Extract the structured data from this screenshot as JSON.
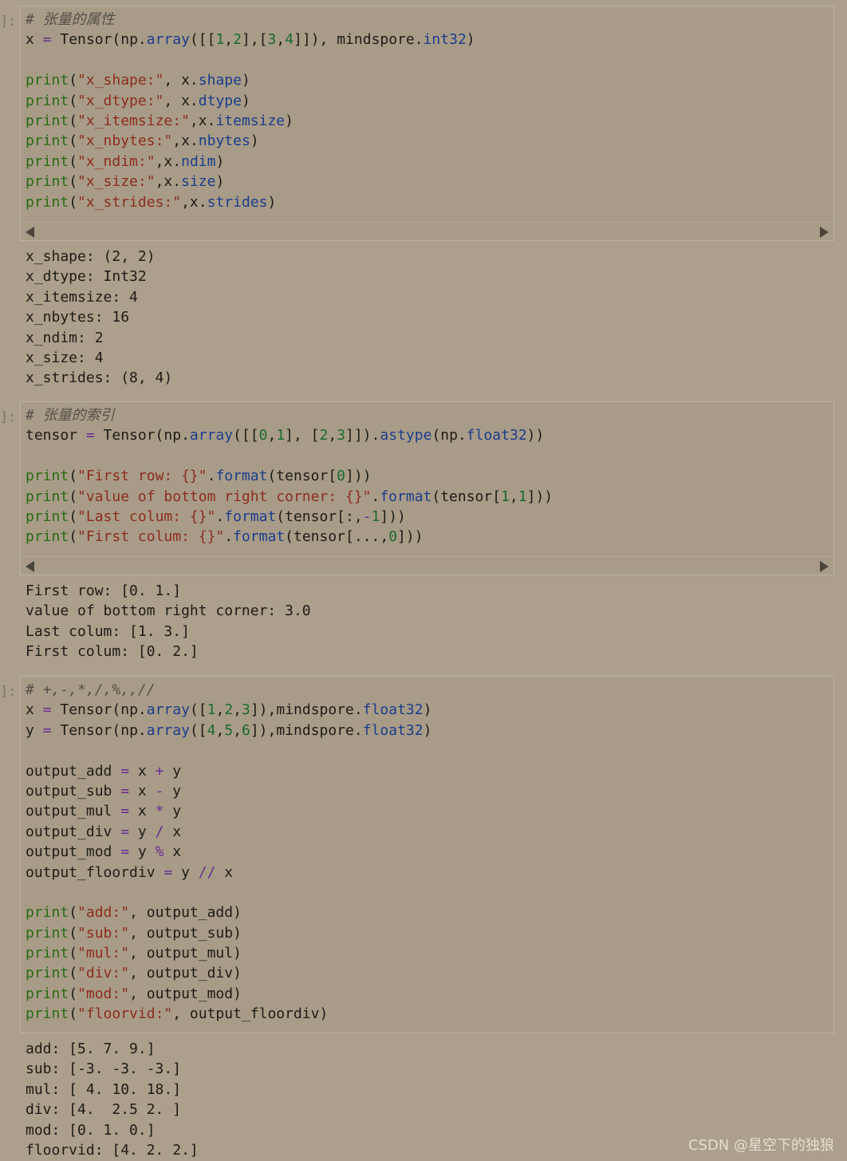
{
  "cells": [
    {
      "prompt": "]:",
      "input_lines": [
        [
          [
            "c",
            "# 张量的属性"
          ]
        ],
        [
          [
            "t",
            "x "
          ],
          [
            "o",
            "="
          ],
          [
            "t",
            " Tensor(np"
          ],
          [
            "t",
            "."
          ],
          [
            "a",
            "array"
          ],
          [
            "t",
            "([["
          ],
          [
            "n",
            "1"
          ],
          [
            "t",
            ","
          ],
          [
            "n",
            "2"
          ],
          [
            "t",
            "],["
          ],
          [
            "n",
            "3"
          ],
          [
            "t",
            ","
          ],
          [
            "n",
            "4"
          ],
          [
            "t",
            "]]), mindspore"
          ],
          [
            "t",
            "."
          ],
          [
            "a",
            "int32"
          ],
          [
            "t",
            ")"
          ]
        ],
        [],
        [
          [
            "k",
            "print"
          ],
          [
            "t",
            "("
          ],
          [
            "s",
            "\"x_shape:\""
          ],
          [
            "t",
            ", x"
          ],
          [
            "t",
            "."
          ],
          [
            "a",
            "shape"
          ],
          [
            "t",
            ")"
          ]
        ],
        [
          [
            "k",
            "print"
          ],
          [
            "t",
            "("
          ],
          [
            "s",
            "\"x_dtype:\""
          ],
          [
            "t",
            ", x"
          ],
          [
            "t",
            "."
          ],
          [
            "a",
            "dtype"
          ],
          [
            "t",
            ")"
          ]
        ],
        [
          [
            "k",
            "print"
          ],
          [
            "t",
            "("
          ],
          [
            "s",
            "\"x_itemsize:\""
          ],
          [
            "t",
            ",x"
          ],
          [
            "t",
            "."
          ],
          [
            "a",
            "itemsize"
          ],
          [
            "t",
            ")"
          ]
        ],
        [
          [
            "k",
            "print"
          ],
          [
            "t",
            "("
          ],
          [
            "s",
            "\"x_nbytes:\""
          ],
          [
            "t",
            ",x"
          ],
          [
            "t",
            "."
          ],
          [
            "a",
            "nbytes"
          ],
          [
            "t",
            ")"
          ]
        ],
        [
          [
            "k",
            "print"
          ],
          [
            "t",
            "("
          ],
          [
            "s",
            "\"x_ndim:\""
          ],
          [
            "t",
            ",x"
          ],
          [
            "t",
            "."
          ],
          [
            "a",
            "ndim"
          ],
          [
            "t",
            ")"
          ]
        ],
        [
          [
            "k",
            "print"
          ],
          [
            "t",
            "("
          ],
          [
            "s",
            "\"x_size:\""
          ],
          [
            "t",
            ",x"
          ],
          [
            "t",
            "."
          ],
          [
            "a",
            "size"
          ],
          [
            "t",
            ")"
          ]
        ],
        [
          [
            "k",
            "print"
          ],
          [
            "t",
            "("
          ],
          [
            "s",
            "\"x_strides:\""
          ],
          [
            "t",
            ",x"
          ],
          [
            "t",
            "."
          ],
          [
            "a",
            "strides"
          ],
          [
            "t",
            ")"
          ]
        ]
      ],
      "has_scrollbar": true,
      "output_lines": [
        "x_shape: (2, 2)",
        "x_dtype: Int32",
        "x_itemsize: 4",
        "x_nbytes: 16",
        "x_ndim: 2",
        "x_size: 4",
        "x_strides: (8, 4)"
      ]
    },
    {
      "prompt": "]:",
      "input_lines": [
        [
          [
            "c",
            "# 张量的索引"
          ]
        ],
        [
          [
            "t",
            "tensor "
          ],
          [
            "o",
            "="
          ],
          [
            "t",
            " Tensor(np"
          ],
          [
            "t",
            "."
          ],
          [
            "a",
            "array"
          ],
          [
            "t",
            "([["
          ],
          [
            "n",
            "0"
          ],
          [
            "t",
            ","
          ],
          [
            "n",
            "1"
          ],
          [
            "t",
            "], ["
          ],
          [
            "n",
            "2"
          ],
          [
            "t",
            ","
          ],
          [
            "n",
            "3"
          ],
          [
            "t",
            "]])"
          ],
          [
            "t",
            "."
          ],
          [
            "a",
            "astype"
          ],
          [
            "t",
            "(np"
          ],
          [
            "t",
            "."
          ],
          [
            "a",
            "float32"
          ],
          [
            "t",
            "))"
          ]
        ],
        [],
        [
          [
            "k",
            "print"
          ],
          [
            "t",
            "("
          ],
          [
            "s",
            "\"First row: {}\""
          ],
          [
            "t",
            "."
          ],
          [
            "a",
            "format"
          ],
          [
            "t",
            "(tensor["
          ],
          [
            "n",
            "0"
          ],
          [
            "t",
            "]))"
          ]
        ],
        [
          [
            "k",
            "print"
          ],
          [
            "t",
            "("
          ],
          [
            "s",
            "\"value of bottom right corner: {}\""
          ],
          [
            "t",
            "."
          ],
          [
            "a",
            "format"
          ],
          [
            "t",
            "(tensor["
          ],
          [
            "n",
            "1"
          ],
          [
            "t",
            ","
          ],
          [
            "n",
            "1"
          ],
          [
            "t",
            "]))"
          ]
        ],
        [
          [
            "k",
            "print"
          ],
          [
            "t",
            "("
          ],
          [
            "s",
            "\"Last colum: {}\""
          ],
          [
            "t",
            "."
          ],
          [
            "a",
            "format"
          ],
          [
            "t",
            "(tensor[:,"
          ],
          [
            "o",
            "-"
          ],
          [
            "n",
            "1"
          ],
          [
            "t",
            "]))"
          ]
        ],
        [
          [
            "k",
            "print"
          ],
          [
            "t",
            "("
          ],
          [
            "s",
            "\"First colum: {}\""
          ],
          [
            "t",
            "."
          ],
          [
            "a",
            "format"
          ],
          [
            "t",
            "(tensor["
          ],
          [
            "t",
            "..."
          ],
          [
            "t",
            ","
          ],
          [
            "n",
            "0"
          ],
          [
            "t",
            "]))"
          ]
        ]
      ],
      "has_scrollbar": true,
      "output_lines": [
        "First row: [0. 1.]",
        "value of bottom right corner: 3.0",
        "Last colum: [1. 3.]",
        "First colum: [0. 2.]"
      ]
    },
    {
      "prompt": "]:",
      "input_lines": [
        [
          [
            "c",
            "# +,-,*,/,%,,//"
          ]
        ],
        [
          [
            "t",
            "x "
          ],
          [
            "o",
            "="
          ],
          [
            "t",
            " Tensor(np"
          ],
          [
            "t",
            "."
          ],
          [
            "a",
            "array"
          ],
          [
            "t",
            "(["
          ],
          [
            "n",
            "1"
          ],
          [
            "t",
            ","
          ],
          [
            "n",
            "2"
          ],
          [
            "t",
            ","
          ],
          [
            "n",
            "3"
          ],
          [
            "t",
            "]),mindspore"
          ],
          [
            "t",
            "."
          ],
          [
            "a",
            "float32"
          ],
          [
            "t",
            ")"
          ]
        ],
        [
          [
            "t",
            "y "
          ],
          [
            "o",
            "="
          ],
          [
            "t",
            " Tensor(np"
          ],
          [
            "t",
            "."
          ],
          [
            "a",
            "array"
          ],
          [
            "t",
            "(["
          ],
          [
            "n",
            "4"
          ],
          [
            "t",
            ","
          ],
          [
            "n",
            "5"
          ],
          [
            "t",
            ","
          ],
          [
            "n",
            "6"
          ],
          [
            "t",
            "]),mindspore"
          ],
          [
            "t",
            "."
          ],
          [
            "a",
            "float32"
          ],
          [
            "t",
            ")"
          ]
        ],
        [],
        [
          [
            "t",
            "output_add "
          ],
          [
            "o",
            "="
          ],
          [
            "t",
            " x "
          ],
          [
            "o",
            "+"
          ],
          [
            "t",
            " y"
          ]
        ],
        [
          [
            "t",
            "output_sub "
          ],
          [
            "o",
            "="
          ],
          [
            "t",
            " x "
          ],
          [
            "o",
            "-"
          ],
          [
            "t",
            " y"
          ]
        ],
        [
          [
            "t",
            "output_mul "
          ],
          [
            "o",
            "="
          ],
          [
            "t",
            " x "
          ],
          [
            "o",
            "*"
          ],
          [
            "t",
            " y"
          ]
        ],
        [
          [
            "t",
            "output_div "
          ],
          [
            "o",
            "="
          ],
          [
            "t",
            " y "
          ],
          [
            "o",
            "/"
          ],
          [
            "t",
            " x"
          ]
        ],
        [
          [
            "t",
            "output_mod "
          ],
          [
            "o",
            "="
          ],
          [
            "t",
            " y "
          ],
          [
            "o",
            "%"
          ],
          [
            "t",
            " x"
          ]
        ],
        [
          [
            "t",
            "output_floordiv "
          ],
          [
            "o",
            "="
          ],
          [
            "t",
            " y "
          ],
          [
            "o",
            "//"
          ],
          [
            "t",
            " x"
          ]
        ],
        [],
        [
          [
            "k",
            "print"
          ],
          [
            "t",
            "("
          ],
          [
            "s",
            "\"add:\""
          ],
          [
            "t",
            ", output_add)"
          ]
        ],
        [
          [
            "k",
            "print"
          ],
          [
            "t",
            "("
          ],
          [
            "s",
            "\"sub:\""
          ],
          [
            "t",
            ", output_sub)"
          ]
        ],
        [
          [
            "k",
            "print"
          ],
          [
            "t",
            "("
          ],
          [
            "s",
            "\"mul:\""
          ],
          [
            "t",
            ", output_mul)"
          ]
        ],
        [
          [
            "k",
            "print"
          ],
          [
            "t",
            "("
          ],
          [
            "s",
            "\"div:\""
          ],
          [
            "t",
            ", output_div)"
          ]
        ],
        [
          [
            "k",
            "print"
          ],
          [
            "t",
            "("
          ],
          [
            "s",
            "\"mod:\""
          ],
          [
            "t",
            ", output_mod)"
          ]
        ],
        [
          [
            "k",
            "print"
          ],
          [
            "t",
            "("
          ],
          [
            "s",
            "\"floorvid:\""
          ],
          [
            "t",
            ", output_floordiv)"
          ]
        ]
      ],
      "has_scrollbar": false,
      "output_lines": [
        "add: [5. 7. 9.]",
        "sub: [-3. -3. -3.]",
        "mul: [ 4. 10. 18.]",
        "div: [4.  2.5 2. ]",
        "mod: [0. 1. 0.]",
        "floorvid: [4. 2. 2.]"
      ]
    }
  ],
  "watermark": "CSDN @星空下的独狼",
  "colors": {
    "background": "#ac9f8b",
    "keyword": "#2a6a12",
    "string": "#8e2c1c",
    "attribute": "#1c3c8c",
    "operator": "#6a2a92",
    "number": "#1a6a2a",
    "comment": "#555048"
  }
}
